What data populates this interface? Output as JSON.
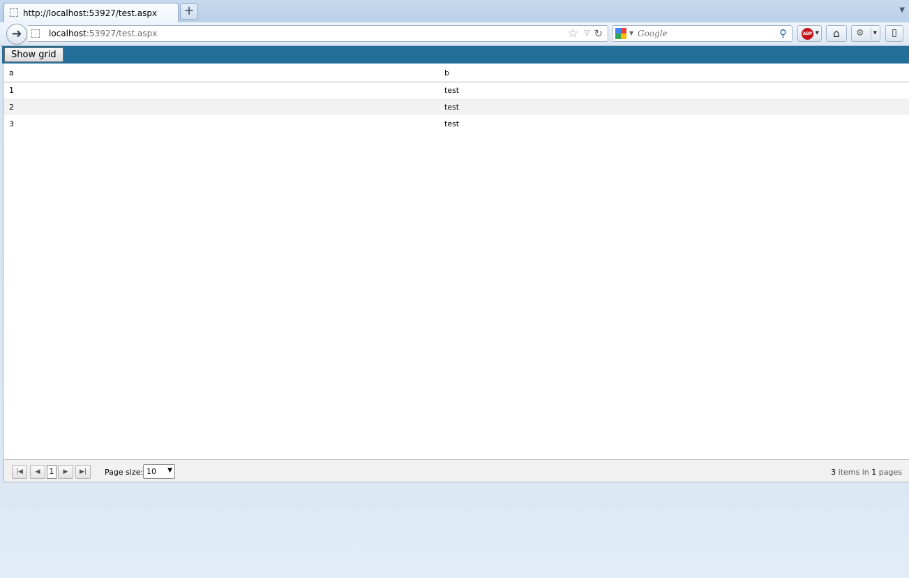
{
  "browser": {
    "tab": {
      "title": "http://localhost:53927/test.aspx"
    },
    "new_tab_glyph": "+",
    "url": {
      "host": "localhost",
      "path": ":53927/test.aspx"
    },
    "search": {
      "placeholder": "Google"
    },
    "abp_label": "ABP"
  },
  "toolbar": {
    "show_grid_label": "Show grid",
    "accent_color": "#246f99"
  },
  "grid": {
    "columns": [
      "a",
      "b"
    ],
    "rows": [
      {
        "a": "1",
        "b": "test"
      },
      {
        "a": "2",
        "b": "test"
      },
      {
        "a": "3",
        "b": "test"
      }
    ]
  },
  "pager": {
    "current_page": "1",
    "page_size_label": "Page size:",
    "page_size_value": "10",
    "info": {
      "count": "3",
      "items_in": "items in",
      "pages_count": "1",
      "pages": "pages"
    }
  }
}
